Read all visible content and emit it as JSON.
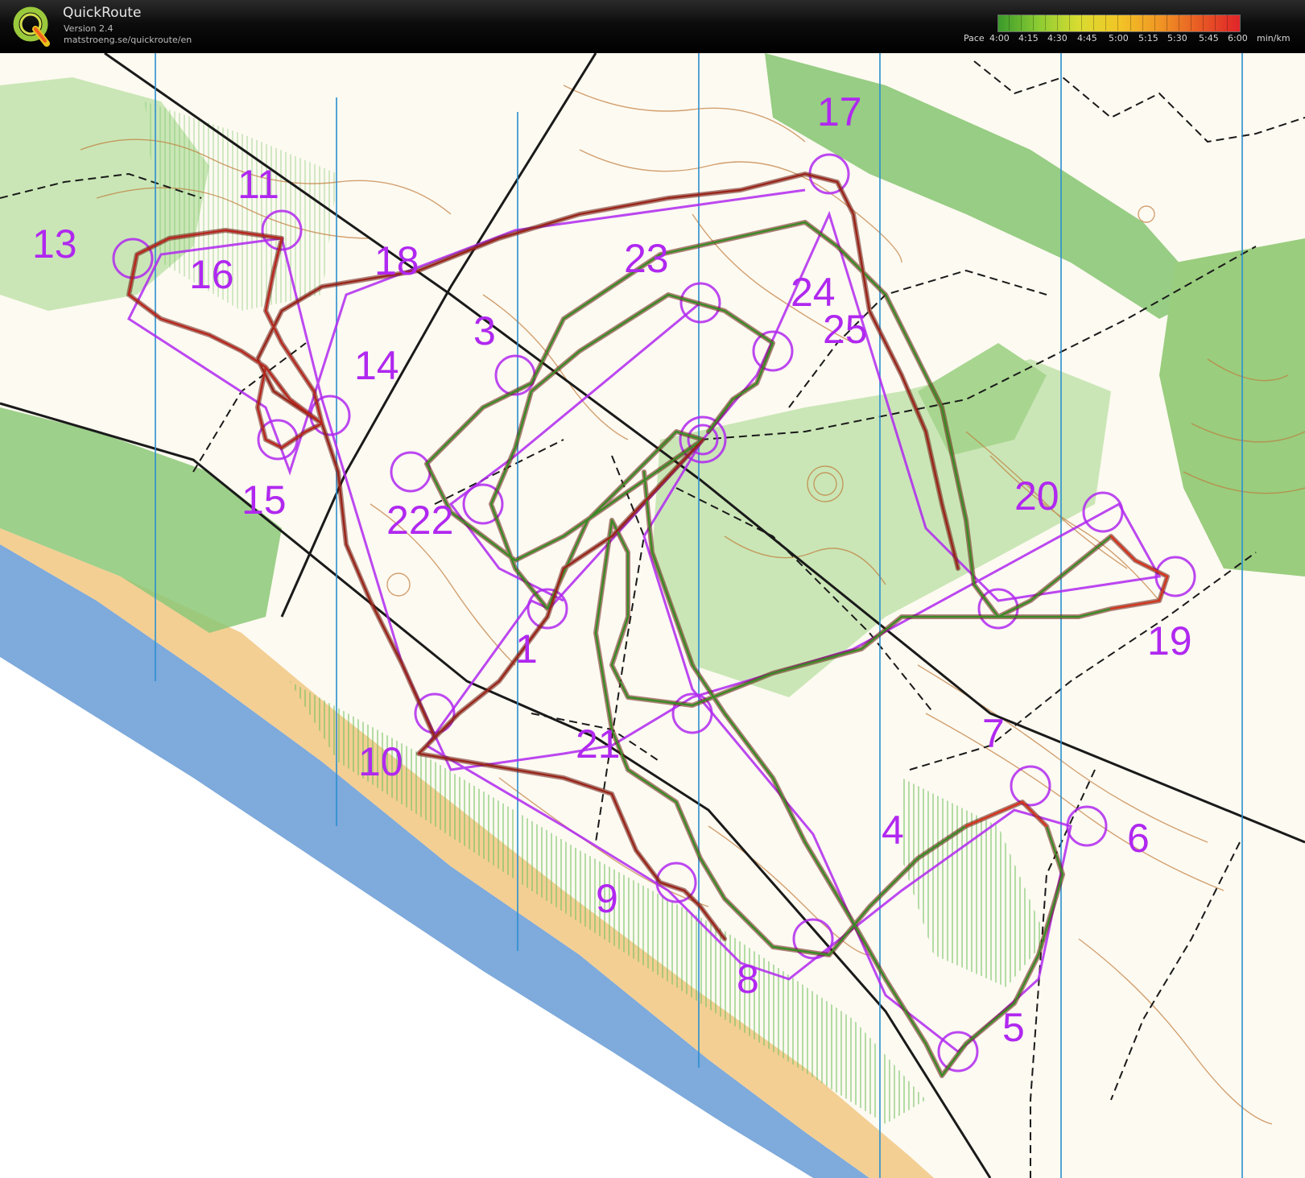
{
  "app": {
    "title": "QuickRoute",
    "version": "Version 2.4",
    "url": "matstroeng.se/quickroute/en"
  },
  "pace_scale": {
    "label": "Pace",
    "ticks": [
      "4:00",
      "4:15",
      "4:30",
      "4:45",
      "5:00",
      "5:15",
      "5:30",
      "5:45",
      "6:00"
    ],
    "unit": "min/km",
    "colors": [
      "#3a9a2c",
      "#8ccc32",
      "#d9dc31",
      "#f2c526",
      "#f09624",
      "#e85a24",
      "#e0242a"
    ]
  },
  "map": {
    "colors": {
      "water": "#7eaadc",
      "sand": "#f3cf94",
      "forest_green": "#8cc878",
      "light_green": "#cae6b6",
      "contour": "#c07a3a",
      "course": "#b028f0",
      "north_line": "#2a8fd0",
      "track": "#7a1a10"
    },
    "controls": [
      "1",
      "3",
      "4",
      "5",
      "6",
      "7",
      "8",
      "9",
      "10",
      "11",
      "13",
      "14",
      "15",
      "16",
      "17",
      "18",
      "19",
      "20",
      "21",
      "22",
      "222",
      "23",
      "24",
      "25"
    ]
  }
}
